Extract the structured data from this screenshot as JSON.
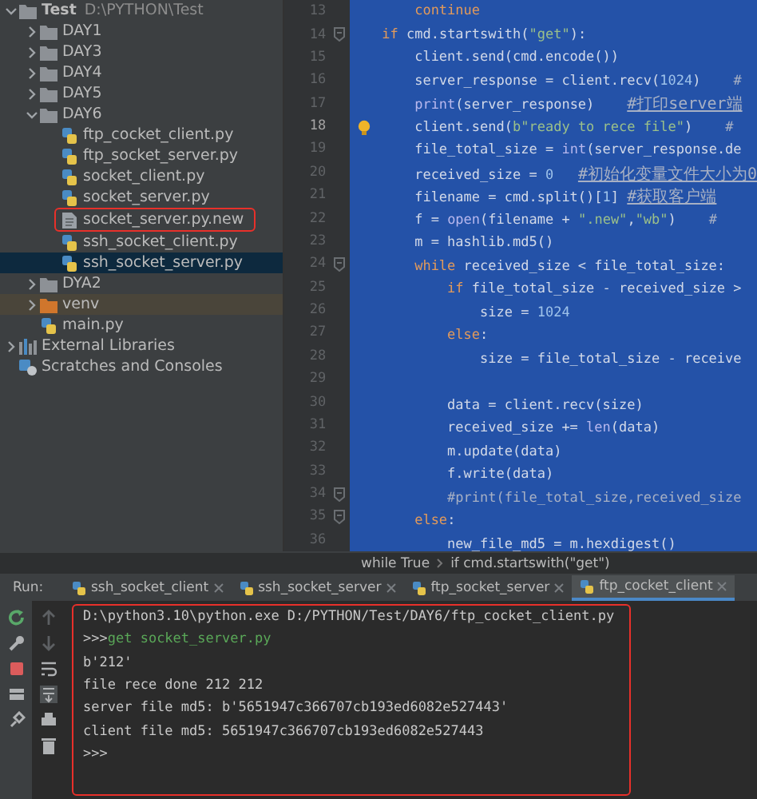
{
  "project_tree": [
    {
      "label": "Test",
      "path": "D:\\PYTHON\\Test",
      "kind": "folder",
      "expanded": true,
      "selected": false,
      "marked": false,
      "children": [
        {
          "label": "DAY1",
          "kind": "folder",
          "expanded": false,
          "selected": false,
          "marked": false
        },
        {
          "label": "DAY3",
          "kind": "folder",
          "expanded": false,
          "selected": false,
          "marked": false
        },
        {
          "label": "DAY4",
          "kind": "folder",
          "expanded": false,
          "selected": false,
          "marked": false
        },
        {
          "label": "DAY5",
          "kind": "folder",
          "expanded": false,
          "selected": false,
          "marked": false
        },
        {
          "label": "DAY6",
          "kind": "folder",
          "expanded": true,
          "selected": false,
          "marked": false,
          "children": [
            {
              "label": "ftp_cocket_client.py",
              "kind": "python",
              "selected": false,
              "marked": false
            },
            {
              "label": "ftp_socket_server.py",
              "kind": "python",
              "selected": false,
              "marked": false
            },
            {
              "label": "socket_client.py",
              "kind": "python",
              "selected": false,
              "marked": false
            },
            {
              "label": "socket_server.py",
              "kind": "python",
              "selected": false,
              "marked": false
            },
            {
              "label": "socket_server.py.new",
              "kind": "text",
              "selected": false,
              "marked": true
            },
            {
              "label": "ssh_socket_client.py",
              "kind": "python",
              "selected": false,
              "marked": false
            },
            {
              "label": "ssh_socket_server.py",
              "kind": "python",
              "selected": true,
              "marked": false
            }
          ]
        },
        {
          "label": "DYA2",
          "kind": "folder",
          "expanded": false,
          "selected": false,
          "marked": false
        },
        {
          "label": "venv",
          "kind": "excluded",
          "expanded": false,
          "selected": false,
          "marked": false
        },
        {
          "label": "main.py",
          "kind": "python",
          "selected": false,
          "marked": false
        }
      ]
    },
    {
      "label": "External Libraries",
      "kind": "libraries",
      "expanded": false,
      "selected": false,
      "marked": false
    },
    {
      "label": "Scratches and Consoles",
      "kind": "scratches",
      "selected": false,
      "marked": false
    }
  ],
  "editor": {
    "lines": [
      {
        "n": "13",
        "current": false,
        "fold": false,
        "bulb": false,
        "tokens": [
          {
            "kind": "kw",
            "text": "    continue"
          }
        ]
      },
      {
        "n": "14",
        "current": false,
        "fold": true,
        "bulb": false,
        "tokens": [
          {
            "kind": "kw",
            "text": "if"
          },
          {
            "kind": "plain",
            "text": " cmd.startswith("
          },
          {
            "kind": "str",
            "text": "\"get\""
          },
          {
            "kind": "plain",
            "text": "):"
          }
        ]
      },
      {
        "n": "15",
        "current": false,
        "fold": false,
        "bulb": false,
        "tokens": [
          {
            "kind": "plain",
            "text": "    client.send(cmd.encode())"
          }
        ]
      },
      {
        "n": "16",
        "current": false,
        "fold": false,
        "bulb": false,
        "tokens": [
          {
            "kind": "plain",
            "text": "    server_response = client.recv("
          },
          {
            "kind": "num",
            "text": "1024"
          },
          {
            "kind": "plain",
            "text": ")    "
          },
          {
            "kind": "comment",
            "text": "#"
          }
        ]
      },
      {
        "n": "17",
        "current": false,
        "fold": false,
        "bulb": false,
        "tokens": [
          {
            "kind": "builtin",
            "text": "    print"
          },
          {
            "kind": "plain",
            "text": "(server_response)    "
          },
          {
            "kind": "cjk",
            "text": "#打印server端"
          }
        ]
      },
      {
        "n": "18",
        "current": true,
        "fold": false,
        "bulb": true,
        "tokens": [
          {
            "kind": "plain",
            "text": "    client.send("
          },
          {
            "kind": "str",
            "text": "b\"ready to rece file\""
          },
          {
            "kind": "plain",
            "text": ")    "
          },
          {
            "kind": "comment",
            "text": "#"
          }
        ]
      },
      {
        "n": "19",
        "current": false,
        "fold": false,
        "bulb": false,
        "tokens": [
          {
            "kind": "plain",
            "text": "    file_total_size = "
          },
          {
            "kind": "builtin",
            "text": "int"
          },
          {
            "kind": "plain",
            "text": "(server_response.de"
          }
        ]
      },
      {
        "n": "20",
        "current": false,
        "fold": false,
        "bulb": false,
        "tokens": [
          {
            "kind": "plain",
            "text": "    received_size = "
          },
          {
            "kind": "num",
            "text": "0   "
          },
          {
            "kind": "cjk",
            "text": "#初始化变量文件大小为0"
          }
        ]
      },
      {
        "n": "21",
        "current": false,
        "fold": false,
        "bulb": false,
        "tokens": [
          {
            "kind": "plain",
            "text": "    filename = cmd.split()["
          },
          {
            "kind": "num",
            "text": "1"
          },
          {
            "kind": "plain",
            "text": "] "
          },
          {
            "kind": "cjk",
            "text": "#获取客户端"
          }
        ]
      },
      {
        "n": "22",
        "current": false,
        "fold": false,
        "bulb": false,
        "tokens": [
          {
            "kind": "plain",
            "text": "    f = "
          },
          {
            "kind": "builtin",
            "text": "open"
          },
          {
            "kind": "plain",
            "text": "(filename + "
          },
          {
            "kind": "str",
            "text": "\".new\""
          },
          {
            "kind": "plain",
            "text": ","
          },
          {
            "kind": "str",
            "text": "\"wb\""
          },
          {
            "kind": "plain",
            "text": ")    "
          },
          {
            "kind": "comment",
            "text": "#"
          }
        ]
      },
      {
        "n": "23",
        "current": false,
        "fold": false,
        "bulb": false,
        "tokens": [
          {
            "kind": "plain",
            "text": "    m = hashlib.md5()"
          }
        ]
      },
      {
        "n": "24",
        "current": false,
        "fold": true,
        "bulb": false,
        "tokens": [
          {
            "kind": "kw",
            "text": "    while"
          },
          {
            "kind": "plain",
            "text": " received_size < file_total_size:"
          }
        ]
      },
      {
        "n": "25",
        "current": false,
        "fold": false,
        "bulb": false,
        "tokens": [
          {
            "kind": "kw",
            "text": "        if"
          },
          {
            "kind": "plain",
            "text": " file_total_size - received_size >"
          }
        ]
      },
      {
        "n": "26",
        "current": false,
        "fold": false,
        "bulb": false,
        "tokens": [
          {
            "kind": "plain",
            "text": "            size = "
          },
          {
            "kind": "num",
            "text": "1024"
          }
        ]
      },
      {
        "n": "27",
        "current": false,
        "fold": false,
        "bulb": false,
        "tokens": [
          {
            "kind": "kw",
            "text": "        else"
          },
          {
            "kind": "plain",
            "text": ":"
          }
        ]
      },
      {
        "n": "28",
        "current": false,
        "fold": false,
        "bulb": false,
        "tokens": [
          {
            "kind": "plain",
            "text": "            size = file_total_size - receive"
          }
        ]
      },
      {
        "n": "29",
        "current": false,
        "fold": false,
        "bulb": false
      },
      {
        "n": "30",
        "current": false,
        "fold": false,
        "bulb": false,
        "tokens": [
          {
            "kind": "plain",
            "text": "        data = client.recv(size)"
          }
        ]
      },
      {
        "n": "31",
        "current": false,
        "fold": false,
        "bulb": false,
        "tokens": [
          {
            "kind": "plain",
            "text": "        received_size += "
          },
          {
            "kind": "builtin",
            "text": "len"
          },
          {
            "kind": "plain",
            "text": "(data)"
          }
        ]
      },
      {
        "n": "32",
        "current": false,
        "fold": false,
        "bulb": false,
        "tokens": [
          {
            "kind": "plain",
            "text": "        m.update(data)"
          }
        ]
      },
      {
        "n": "33",
        "current": false,
        "fold": false,
        "bulb": false,
        "tokens": [
          {
            "kind": "plain",
            "text": "        f.write(data)"
          }
        ]
      },
      {
        "n": "34",
        "current": false,
        "fold": true,
        "bulb": false,
        "tokens": [
          {
            "kind": "comment",
            "text": "        #print(file_total_size,received_size"
          }
        ]
      },
      {
        "n": "35",
        "current": false,
        "fold": true,
        "bulb": false,
        "tokens": [
          {
            "kind": "kw",
            "text": "    else"
          },
          {
            "kind": "plain",
            "text": ":"
          }
        ]
      },
      {
        "n": "36",
        "current": false,
        "fold": false,
        "bulb": false,
        "tokens": [
          {
            "kind": "plain",
            "text": "        new_file_md5 = m.hexdigest()"
          }
        ]
      }
    ]
  },
  "breadcrumbs": [
    "while True",
    "if cmd.startswith(\"get\")"
  ],
  "run": {
    "label": "Run:",
    "marked": true,
    "tabs": [
      {
        "label": "ssh_socket_client",
        "selected": false
      },
      {
        "label": "ssh_socket_server",
        "selected": false
      },
      {
        "label": "ftp_socket_server",
        "selected": false
      },
      {
        "label": "ftp_cocket_client",
        "selected": true
      }
    ],
    "console": [
      {
        "kind": "output",
        "text": "D:\\python3.10\\python.exe D:/PYTHON/Test/DAY6/ftp_cocket_client.py"
      },
      {
        "kind": "prompt",
        "prompt": ">>>",
        "input": "get socket_server.py"
      },
      {
        "kind": "output",
        "text": "b'212'"
      },
      {
        "kind": "output",
        "text": "file rece done 212 212"
      },
      {
        "kind": "output",
        "text": "server file md5: b'5651947c366707cb193ed6082e527443'"
      },
      {
        "kind": "output",
        "text": "client file md5: 5651947c366707cb193ed6082e527443"
      },
      {
        "kind": "prompt",
        "prompt": ">>>"
      }
    ]
  }
}
